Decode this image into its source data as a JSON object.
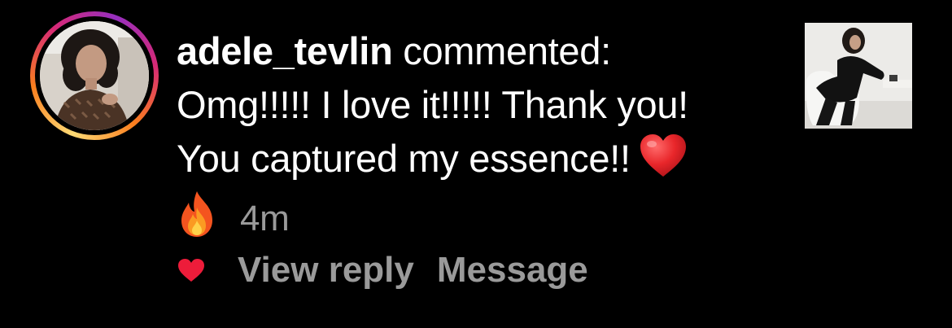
{
  "comment": {
    "username": "adele_tevlin",
    "action_text": " commented:",
    "line1": "Omg!!!!! I love it!!!!! Thank you!",
    "line2": "You captured my essence!!",
    "timestamp": "4m"
  },
  "icons": {
    "heart_emoji": "red-heart-emoji",
    "fire_emoji": "fire-emoji",
    "like": "heart-icon"
  },
  "actions": {
    "view_reply": "View reply",
    "message": "Message"
  },
  "colors": {
    "background": "#000000",
    "text": "#ffffff",
    "secondary_text": "#9a9a9a",
    "like_heart": "#ed1c3a"
  }
}
